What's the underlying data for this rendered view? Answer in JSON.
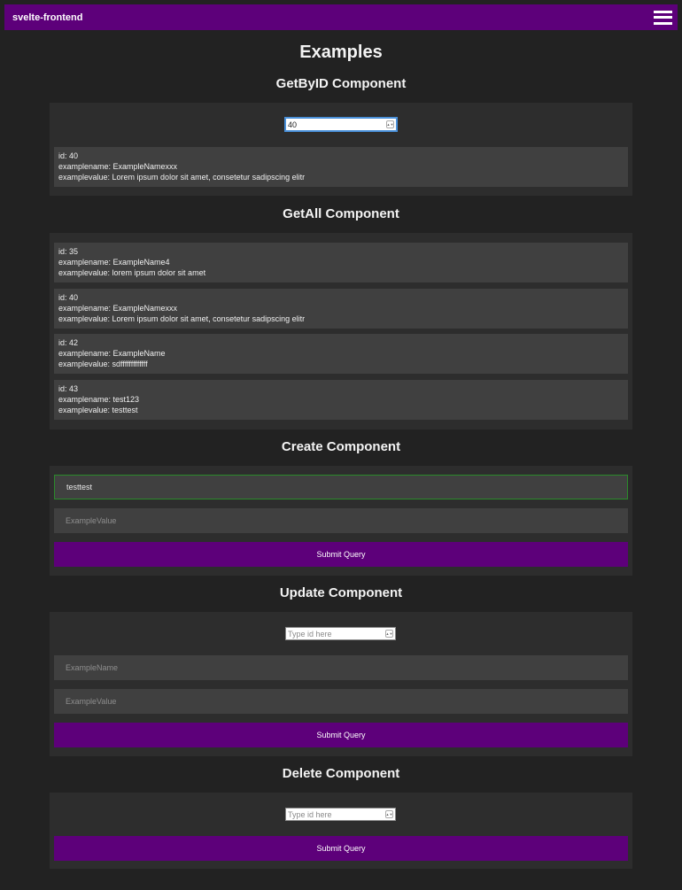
{
  "app": {
    "brand": "svelte-frontend"
  },
  "page": {
    "title": "Examples"
  },
  "getById": {
    "title": "GetByID Component",
    "input_value": "40",
    "result": {
      "id": "id: 40",
      "name": "examplename: ExampleNamexxx",
      "value": "examplevalue: Lorem ipsum dolor sit amet, consetetur sadipscing elitr"
    }
  },
  "getAll": {
    "title": "GetAll Component",
    "items": [
      {
        "id": "id: 35",
        "name": "examplename: ExampleName4",
        "value": "examplevalue: lorem ipsum dolor sit amet"
      },
      {
        "id": "id: 40",
        "name": "examplename: ExampleNamexxx",
        "value": "examplevalue: Lorem ipsum dolor sit amet, consetetur sadipscing elitr"
      },
      {
        "id": "id: 42",
        "name": "examplename: ExampleName",
        "value": "examplevalue: sdfffffffffffff"
      },
      {
        "id": "id: 43",
        "name": "examplename: test123",
        "value": "examplevalue: testtest"
      }
    ]
  },
  "create": {
    "title": "Create Component",
    "name_value": "testtest",
    "value_placeholder": "ExampleValue",
    "submit_label": "Submit Query"
  },
  "update": {
    "title": "Update Component",
    "id_placeholder": "Type id here",
    "name_placeholder": "ExampleName",
    "value_placeholder": "ExampleValue",
    "submit_label": "Submit Query"
  },
  "delete": {
    "title": "Delete Component",
    "id_placeholder": "Type id here",
    "submit_label": "Submit Query"
  },
  "colors": {
    "accent": "#5d007a",
    "background": "#222222",
    "panel": "#2d2d2d",
    "card": "#404040",
    "focus": "#4a90d9",
    "valid_border": "#2a8a2a"
  }
}
